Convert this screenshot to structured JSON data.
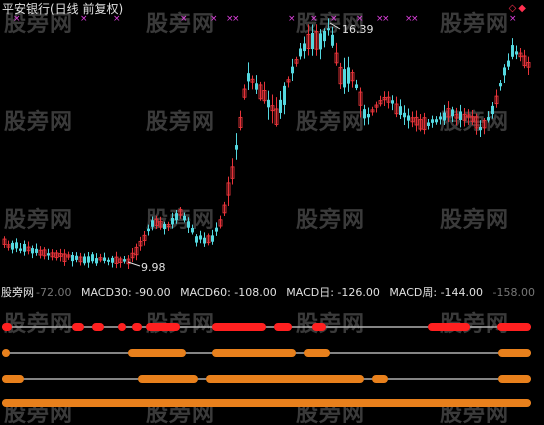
{
  "header": {
    "title": "平安银行(日线 前复权)",
    "corner_icons": "◇◆"
  },
  "price_chart": {
    "high_label": "16.39",
    "low_label": "9.98",
    "up_color": "#e8343a",
    "down_color": "#54d8e0",
    "marker_color": "#e040e0",
    "marker_glyph": "×"
  },
  "indicator_panel": {
    "label": "股旁网",
    "readouts": [
      {
        "label": "-72.00",
        "dim": true
      },
      {
        "label": "MACD30: -90.00",
        "dim": false
      },
      {
        "label": "MACD60: -108.00",
        "dim": false
      },
      {
        "label": "MACD日: -126.00",
        "dim": false
      },
      {
        "label": "MACD周: -144.00",
        "dim": false
      },
      {
        "label": "-158.00",
        "dim": true
      }
    ],
    "line_colors": [
      "#ff2020",
      "#e8801c",
      "#e8801c",
      "#e8801c"
    ],
    "base_line_color": "#b0b0b0"
  },
  "watermark": {
    "text": "股旁网"
  }
}
